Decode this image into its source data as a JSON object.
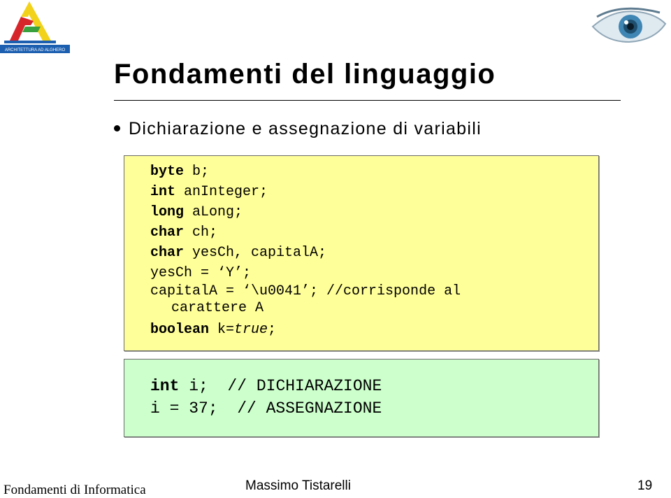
{
  "logo": {
    "caption": "ARCHITETTURA AD ALGHERO",
    "colors": {
      "yellow": "#f2d21a",
      "red": "#d7262b",
      "green": "#3aa13f",
      "blue": "#1c5fb0"
    }
  },
  "slide": {
    "title": "Fondamenti del linguaggio",
    "bullet": "Dichiarazione e assegnazione di variabili"
  },
  "code_yellow": {
    "background": "#ffff99",
    "lines": [
      {
        "kw": "byte",
        "rest": " b;"
      },
      {
        "kw": "int",
        "rest": " anInteger;"
      },
      {
        "kw": "long",
        "rest": " aLong;"
      },
      {
        "kw": "char",
        "rest": " ch;"
      },
      {
        "kw": "char",
        "rest": " yesCh, capitalA;"
      },
      {
        "text": "yesCh = ‘Y’;"
      },
      {
        "text": "capitalA = ‘\\u0041’; //corrisponde al"
      },
      {
        "text": "carattere A"
      },
      {
        "kw": "boolean",
        "rest": " k=",
        "italic": "true",
        "tail": ";"
      }
    ]
  },
  "code_green": {
    "background": "#ccffcc",
    "lines": [
      {
        "kw": "int",
        "rest": " i;  // DICHIARAZIONE"
      },
      {
        "text": "i = 37;  // ASSEGNAZIONE"
      }
    ]
  },
  "footer": {
    "left": "Fondamenti di Informatica",
    "center": "Massimo Tistarelli",
    "page": "19"
  }
}
